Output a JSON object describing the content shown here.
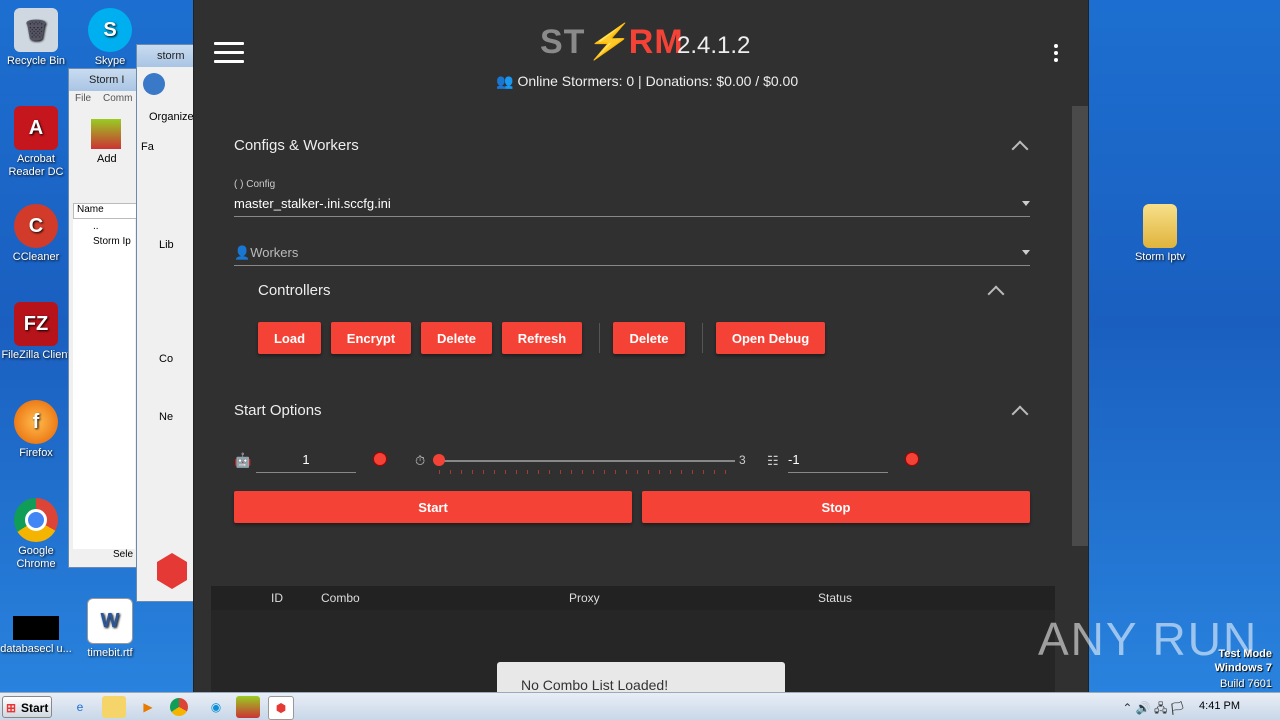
{
  "desktop": {
    "icons_left": [
      {
        "label": "Recycle Bin",
        "icon": "recycle-bin-icon"
      },
      {
        "label": "Acrobat Reader DC",
        "icon": "acrobat-icon"
      },
      {
        "label": "CCleaner",
        "icon": "ccleaner-icon"
      },
      {
        "label": "FileZilla Client",
        "icon": "filezilla-icon"
      },
      {
        "label": "Firefox",
        "icon": "firefox-icon"
      },
      {
        "label": "Google Chrome",
        "icon": "chrome-icon"
      },
      {
        "label": "databasecl u...",
        "icon": "black-file-icon"
      }
    ],
    "icons_col2": [
      {
        "label": "Skype",
        "icon": "skype-icon"
      },
      {
        "label": "timebit.rtf",
        "icon": "word-doc-icon"
      }
    ],
    "icon_right": {
      "label": "Storm Iptv",
      "icon": "folder-icon"
    },
    "bg_windows": {
      "winrar_title": "Storm I",
      "winrar_menu": [
        "File",
        "Comm"
      ],
      "winrar_add": "Add",
      "winrar_col": "Name",
      "winrar_rows": [
        "..",
        "Storm Ip"
      ],
      "winrar_status": "Sele",
      "explorer_title": "storm",
      "explorer_organize": "Organize",
      "explorer_items": [
        "Fa",
        "Lib",
        "Co",
        "Ne"
      ]
    }
  },
  "app": {
    "logo_left": "ST",
    "logo_right": "RM",
    "version": "2.4.1.2",
    "stats": "Online Stormers: 0 | Donations: $0.00 / $0.00",
    "sections": {
      "configs_workers": "Configs & Workers",
      "config_label": "Config",
      "config_value": "master_stalker-.ini.sccfg.ini",
      "workers_label": "Workers",
      "controllers": "Controllers",
      "start_options": "Start Options"
    },
    "buttons": {
      "load": "Load",
      "encrypt": "Encrypt",
      "delete1": "Delete",
      "refresh": "Refresh",
      "delete2": "Delete",
      "open_debug": "Open Debug",
      "start": "Start",
      "stop": "Stop"
    },
    "start_options": {
      "bots": "1",
      "slider_max": "3",
      "slider_value_fraction": 0.0,
      "retries": "-1"
    },
    "table": {
      "columns": [
        "ID",
        "Combo",
        "Proxy",
        "Status"
      ]
    },
    "toast": "No Combo List Loaded!"
  },
  "taskbar": {
    "start": "Start",
    "clock": "4:41 PM"
  },
  "watermark": {
    "anyrun": "ANY RUN",
    "line1": "Test Mode",
    "line2": "Windows 7",
    "line3": "Build 7601"
  },
  "colors": {
    "accent": "#f44336",
    "app_bg": "#303030"
  }
}
